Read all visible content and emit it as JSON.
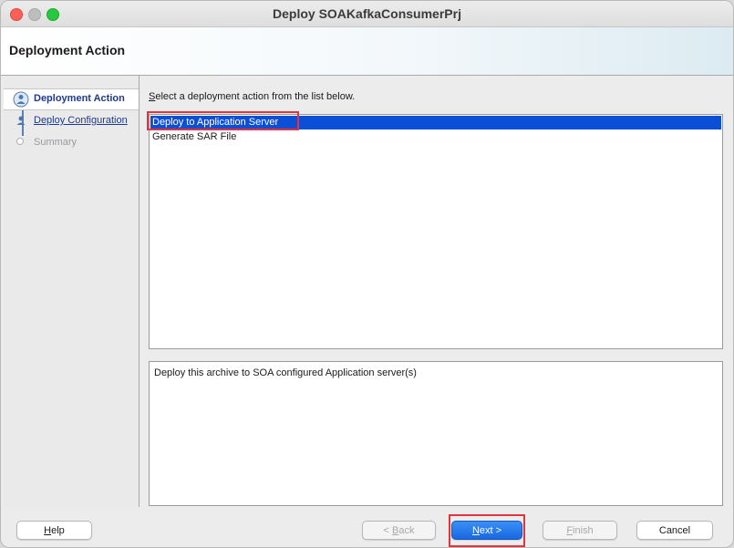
{
  "window": {
    "title": "Deploy SOAKafkaConsumerPrj"
  },
  "banner": {
    "title": "Deployment Action"
  },
  "nav": {
    "items": [
      {
        "label": "Deployment Action",
        "state": "active",
        "icon": "person-train-stop-icon"
      },
      {
        "label": "Deploy Configuration",
        "state": "link",
        "icon": "person-train-stop-icon"
      },
      {
        "label": "Summary",
        "state": "disabled",
        "icon": "empty-circle-icon"
      }
    ]
  },
  "main": {
    "instruction_first": "S",
    "instruction_rest": "elect a deployment action from the list below.",
    "list": [
      {
        "label": "Deploy to Application Server",
        "selected": true
      },
      {
        "label": "Generate SAR File",
        "selected": false
      }
    ],
    "description": "Deploy this archive to SOA configured Application server(s)"
  },
  "buttons": {
    "help_first": "H",
    "help_rest": "elp",
    "back_prefix": "< ",
    "back_first": "B",
    "back_rest": "ack",
    "next_first": "N",
    "next_rest": "ext >",
    "finish_first": "F",
    "finish_rest": "inish",
    "cancel": "Cancel"
  },
  "colors": {
    "selection": "#0a4fd6",
    "highlight": "#e0343f",
    "primary_button": "#1868e0"
  }
}
